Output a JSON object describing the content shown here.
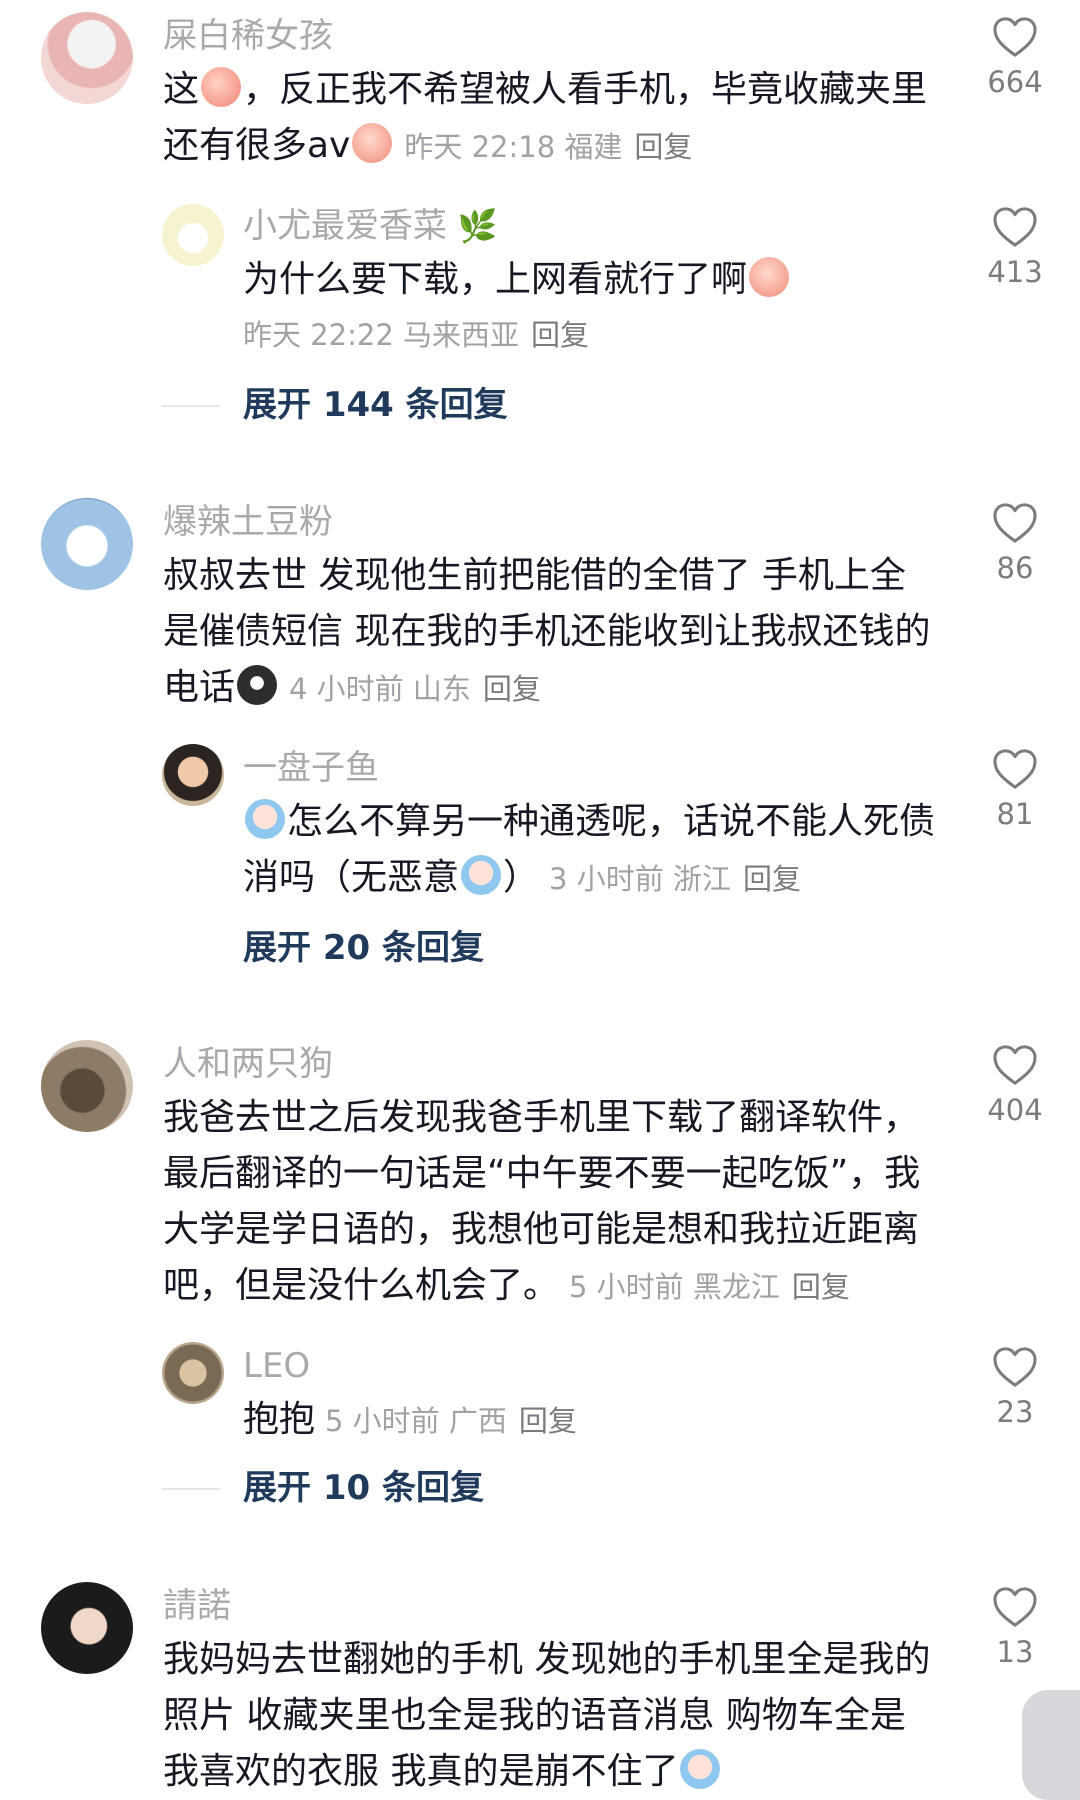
{
  "comments": [
    {
      "user": "屎白稀女孩",
      "text_before": "这",
      "text_after": "，反正我不希望被人看手机，毕竟收藏夹里还有很多av",
      "time": "昨天 22:18",
      "location": "福建",
      "reply_label": "回复",
      "likes": "664",
      "reply": {
        "user": "小尤最爱香菜",
        "text": "为什么要下载，上网看就行了啊",
        "time": "昨天 22:22",
        "location": "马来西亚",
        "reply_label": "回复",
        "likes": "413"
      },
      "expand_label": "展开 144 条回复"
    },
    {
      "user": "爆辣土豆粉",
      "text": "叔叔去世 发现他生前把能借的全借了 手机上全是催债短信 现在我的手机还能收到让我叔还钱的电话",
      "time": "4 小时前",
      "location": "山东",
      "reply_label": "回复",
      "likes": "86",
      "reply": {
        "user": "一盘子鱼",
        "text_before": "怎么不算另一种通透呢，话说不能人死债消吗（无恶意",
        "text_after": "）",
        "time": "3 小时前",
        "location": "浙江",
        "reply_label": "回复",
        "likes": "81"
      },
      "expand_label": "展开 20 条回复"
    },
    {
      "user": "人和两只狗",
      "text": "我爸去世之后发现我爸手机里下载了翻译软件，最后翻译的一句话是“中午要不要一起吃饭”，我大学是学日语的，我想他可能是想和我拉近距离吧，但是没什么机会了。",
      "time": "5 小时前",
      "location": "黑龙江",
      "reply_label": "回复",
      "likes": "404",
      "reply": {
        "user": "LEO",
        "text": "抱抱",
        "time": "5 小时前",
        "location": "广西",
        "reply_label": "回复",
        "likes": "23"
      },
      "expand_label": "展开 10 条回复"
    },
    {
      "user": "請諾",
      "text": "我妈妈去世翻她的手机 发现她的手机里全是我的照片 收藏夹里也全是我的语音消息 购物车全是我喜欢的衣服 我真的是崩不住了",
      "likes": "13"
    }
  ]
}
